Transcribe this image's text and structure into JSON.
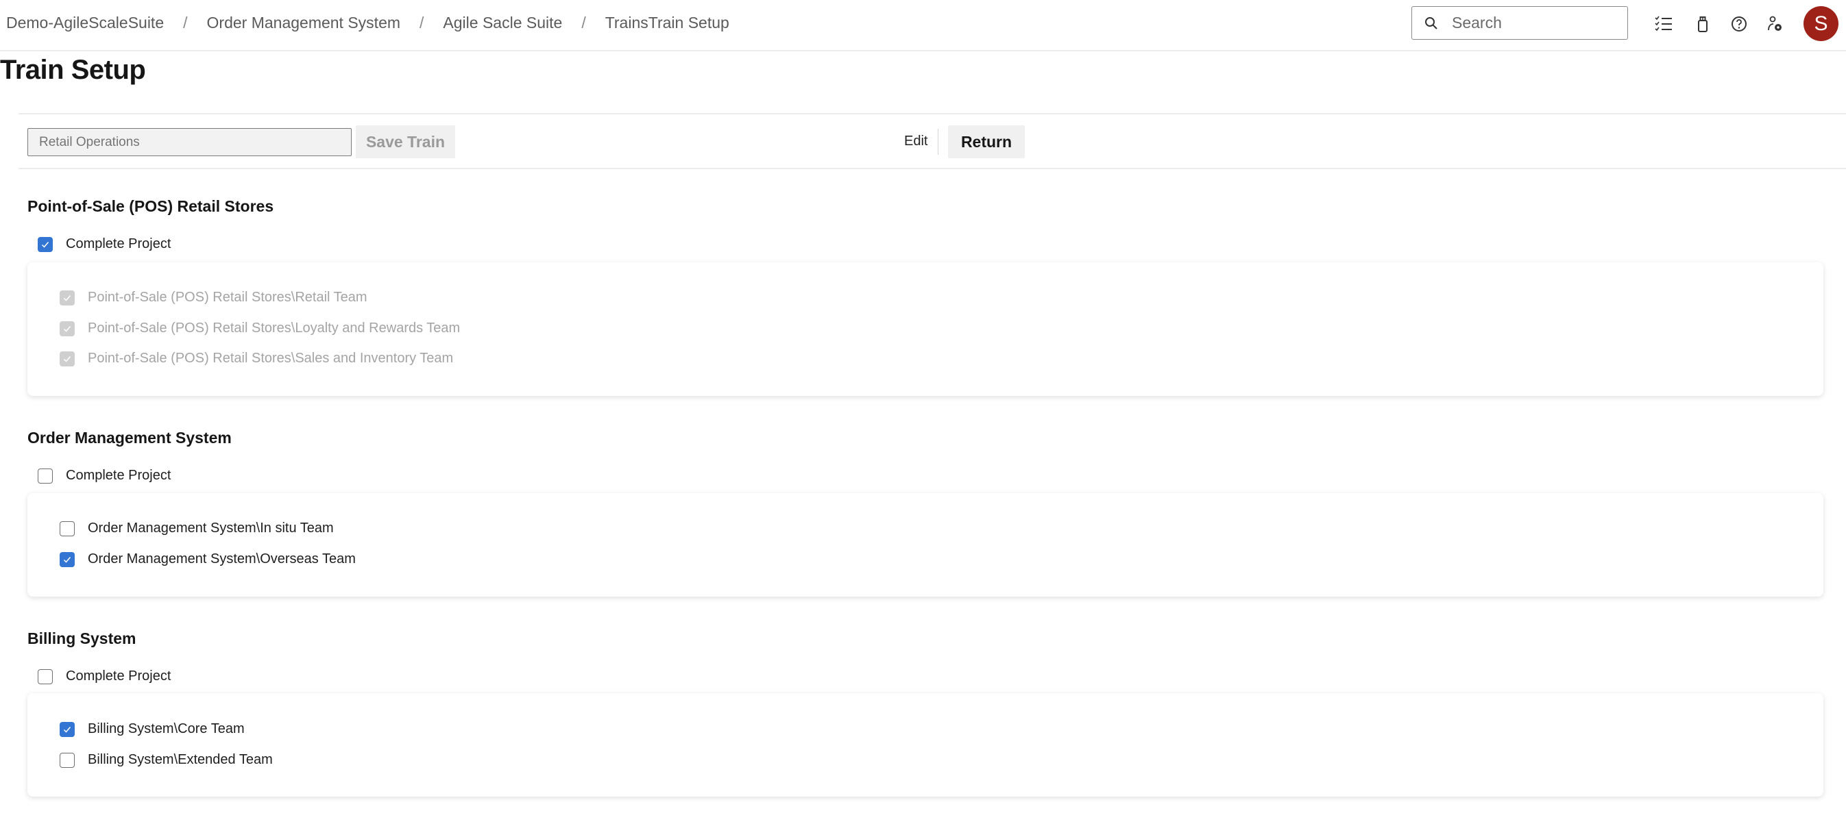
{
  "header": {
    "breadcrumbs": [
      "Demo-AgileScaleSuite",
      "Order Management System",
      "Agile Sacle Suite",
      "TrainsTrain Setup"
    ],
    "breadcrumb_separator": "/",
    "search_placeholder": "Search",
    "icons": [
      "checklist-icon",
      "shopping-bag-icon",
      "help-icon",
      "user-settings-icon"
    ],
    "avatar_initial": "S",
    "avatar_color": "#9e2218"
  },
  "page": {
    "title": "Train Setup"
  },
  "toolbar": {
    "train_name_value": "",
    "train_name_placeholder": "Retail Operations",
    "save_label": "Save Train",
    "edit_label": "Edit",
    "return_label": "Return"
  },
  "accent_color": "#3275d3",
  "projects": [
    {
      "title": "Point-of-Sale (POS) Retail Stores",
      "complete_label": "Complete Project",
      "complete_checked": true,
      "teams": [
        {
          "label": "Point-of-Sale (POS) Retail Stores\\Retail Team",
          "checked": true,
          "disabled": true
        },
        {
          "label": "Point-of-Sale (POS) Retail Stores\\Loyalty and Rewards Team",
          "checked": true,
          "disabled": true
        },
        {
          "label": "Point-of-Sale (POS) Retail Stores\\Sales and Inventory Team",
          "checked": true,
          "disabled": true
        }
      ]
    },
    {
      "title": "Order Management System",
      "complete_label": "Complete Project",
      "complete_checked": false,
      "teams": [
        {
          "label": "Order Management System\\In situ Team",
          "checked": false,
          "disabled": false
        },
        {
          "label": "Order Management System\\Overseas Team",
          "checked": true,
          "disabled": false
        }
      ]
    },
    {
      "title": "Billing System",
      "complete_label": "Complete Project",
      "complete_checked": false,
      "teams": [
        {
          "label": "Billing System\\Core Team",
          "checked": true,
          "disabled": false
        },
        {
          "label": "Billing System\\Extended Team",
          "checked": false,
          "disabled": false
        }
      ]
    }
  ]
}
